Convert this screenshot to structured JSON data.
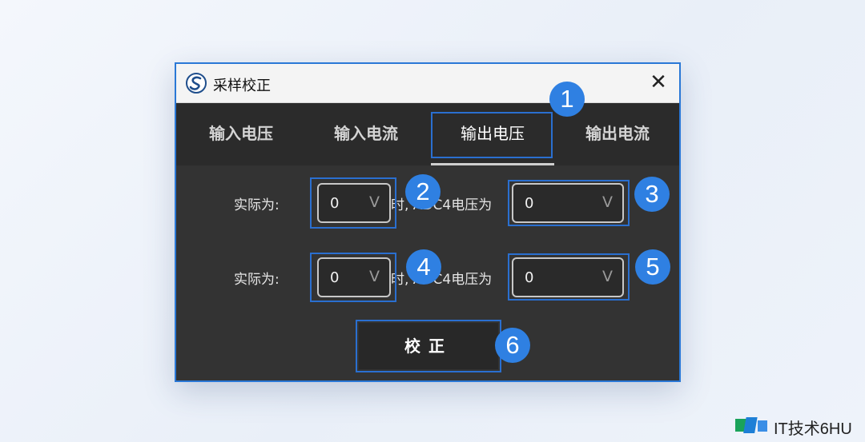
{
  "window": {
    "title": "采样校正",
    "close_glyph": "✕",
    "app_icon": "logo-icon"
  },
  "tabs": [
    {
      "label": "输入电压",
      "active": false
    },
    {
      "label": "输入电流",
      "active": false
    },
    {
      "label": "输出电压",
      "active": true
    },
    {
      "label": "输出电流",
      "active": false
    }
  ],
  "rows": [
    {
      "actual_label": "实际为:",
      "actual_value": "0",
      "mid_label": "时, ADC4电压为",
      "adc_value": "0"
    },
    {
      "actual_label": "实际为:",
      "actual_value": "0",
      "mid_label": "时, ADC4电压为",
      "adc_value": "0"
    }
  ],
  "dropdown_arrow": "V",
  "calibrate_label": "校正",
  "badges": [
    "1",
    "2",
    "3",
    "4",
    "5",
    "6"
  ],
  "watermark": {
    "text": "IT技术6HU"
  },
  "colors": {
    "accent_blue": "#2f80e2",
    "highlight_border": "#2a6fd0",
    "panel_bg": "#333333",
    "tab_bg": "#2b2b2b"
  }
}
